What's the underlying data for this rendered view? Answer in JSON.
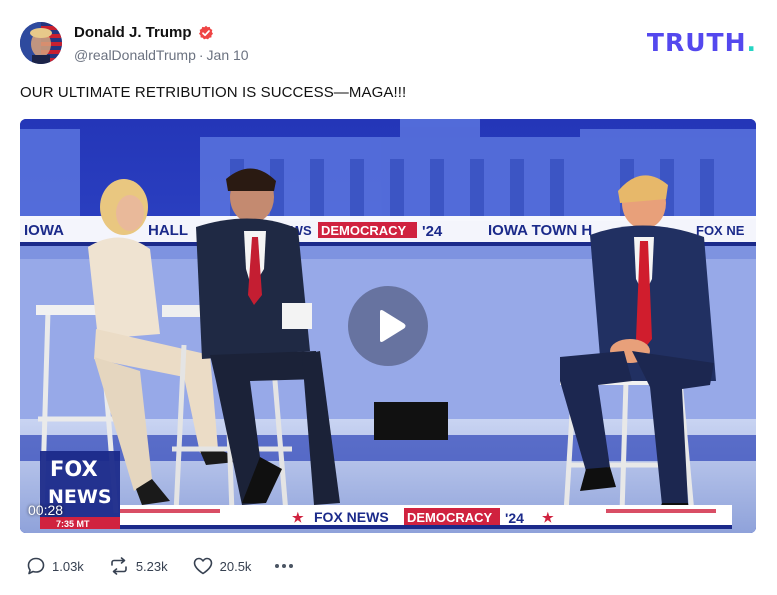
{
  "post": {
    "author": {
      "display_name": "Donald J. Trump",
      "handle": "@realDonaldTrump",
      "date": "Jan 10",
      "verified": true
    },
    "brand": "TRUTH",
    "brand_period": ".",
    "text": "OUR ULTIMATE RETRIBUTION IS SUCCESS—MAGA!!!",
    "video": {
      "duration": "00:28",
      "banner_top": [
        "IOWA",
        "HALL",
        "EWS",
        "DEMOCRACY",
        "'24",
        "IOWA TOWN H",
        "FOX NE"
      ],
      "banner_bottom": [
        "FOX NEWS",
        "DEMOCRACY",
        "'24"
      ],
      "logo_line1": "FOX",
      "logo_line2": "NEWS",
      "logo_line3": "7:35 MT"
    },
    "actions": {
      "replies": "1.03k",
      "retruths": "5.23k",
      "likes": "20.5k"
    }
  },
  "colors": {
    "brand": "#5448ee",
    "brand_period": "#25d5c3",
    "verified": "#ef4444",
    "muted_text": "#6b7280",
    "fox_red": "#d0223f",
    "stage_blue": "#2a3aa8"
  },
  "icons": {
    "verified": "verified-badge-icon",
    "reply": "reply-bubble-icon",
    "retruth": "retruth-arrows-icon",
    "like": "heart-icon",
    "more": "more-dots-icon",
    "play": "play-icon"
  }
}
